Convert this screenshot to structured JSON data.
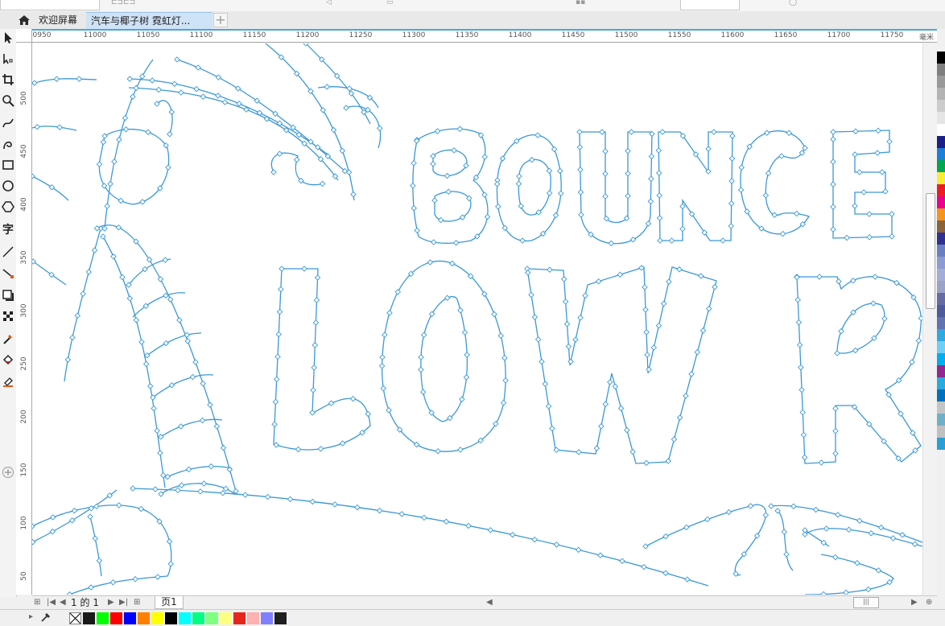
{
  "tabs": [
    {
      "label": "欢迎屏幕"
    },
    {
      "label": "汽车与椰子树 霓虹灯..."
    }
  ],
  "ruler": {
    "unit": "毫米",
    "h_ticks": [
      "0950",
      "11000",
      "11050",
      "11100",
      "11150",
      "11200",
      "11250",
      "11300",
      "11350",
      "11400",
      "11450",
      "11500",
      "11550",
      "11600",
      "11650",
      "11700",
      "11750"
    ],
    "v_ticks": [
      "500",
      "450",
      "400",
      "350",
      "300",
      "250",
      "200",
      "150",
      "100",
      "50"
    ]
  },
  "canvas_text": {
    "line1": "BOUNCE",
    "line2": "LOW R"
  },
  "pages": {
    "current": "1",
    "of_label": "的",
    "total": "1",
    "page_tab": "页1"
  },
  "colors": {
    "outline": "#3a98d8",
    "palette": [
      "#000000",
      "#7f7f7f",
      "#999999",
      "#b3b3b3",
      "#cccccc",
      "#e5e5e5",
      "#ffffff",
      "#1a1f8a",
      "#1e7fd6",
      "#00a651",
      "#f9ed32",
      "#ed1c24",
      "#ec008c",
      "#f7941d",
      "#8c6239",
      "#2e3192",
      "#6a7fc1",
      "#8c9bd3",
      "#a3add6",
      "#9aa2c7",
      "#656ba3",
      "#4d5a9c",
      "#5f72b2",
      "#30a8e0",
      "#6dcff6",
      "#00aeef",
      "#92278f",
      "#29abe2",
      "#0071bc",
      "#c4c4c4",
      "#6fb0c8",
      "#c0c0c0",
      "#2a9fd6"
    ],
    "status_swatches": [
      "#1a1a1a",
      "#00ff00",
      "#ff0000",
      "#0000ff",
      "#ff8000",
      "#ffff00",
      "#000000",
      "#00ffff",
      "#00ff80",
      "#80ff80",
      "#ffff80",
      "#e8251c",
      "#ffb0b0",
      "#8080ff",
      "#1f1f1f"
    ]
  }
}
